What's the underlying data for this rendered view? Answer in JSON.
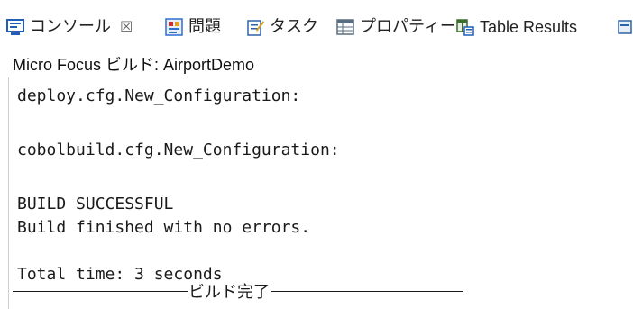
{
  "tabs": [
    {
      "label": "コンソール",
      "icon": "console-icon",
      "active": true,
      "close": "☒"
    },
    {
      "label": "問題",
      "icon": "problems-icon"
    },
    {
      "label": "タスク",
      "icon": "tasks-icon"
    },
    {
      "label": "プロパティー",
      "icon": "properties-icon"
    },
    {
      "label": "Table Results",
      "icon": "table-results-icon"
    }
  ],
  "console": {
    "title": "Micro Focus ビルド: AirportDemo",
    "lines": {
      "deploy": "deploy.cfg.New_Configuration:",
      "cobolbuild": "cobolbuild.cfg.New_Configuration:",
      "status": "BUILD SUCCESSFUL",
      "finished": "Build finished with no errors.",
      "total": "Total time: 3 seconds"
    },
    "footer": "ビルド完了"
  },
  "colors": {
    "console_icon": "#1f5fb5",
    "problems_icon": "#2e6fd0",
    "tasks_icon": "#2f63a8",
    "properties_icon": "#5a6d80",
    "table_icon": "#3b6f2c"
  }
}
